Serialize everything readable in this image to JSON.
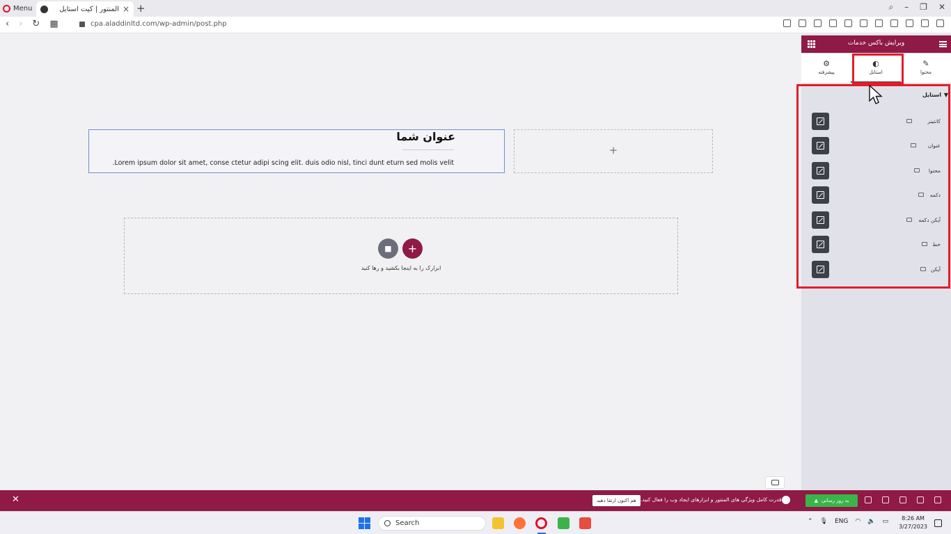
{
  "browser": {
    "menu_label": "Menu",
    "tab_title": "المنتور | کیت استایل",
    "url": "cpa.aladdinltd.com/wp-admin/post.php"
  },
  "canvas": {
    "heading_title": "عنوان شما",
    "heading_text": ".Lorem ipsum dolor sit amet, conse ctetur adipi scing elit. duis odio nisl, tinci dunt eturn sed molis velit",
    "empty_column_plus": "+",
    "add_button": "+",
    "drop_text": "ابزارک را به اینجا بکشید و رها کنید"
  },
  "panel": {
    "title": "ویرایش باکس خدمات",
    "tabs": [
      {
        "label": "محتوا",
        "icon": "pencil-icon"
      },
      {
        "label": "استایل",
        "icon": "contrast-icon"
      },
      {
        "label": "پیشرفته",
        "icon": "gear-icon"
      }
    ],
    "section_title": "استایل",
    "rows": [
      {
        "label": "کانتینر"
      },
      {
        "label": "عنوان"
      },
      {
        "label": "محتوا"
      },
      {
        "label": "دکمه"
      },
      {
        "label": "آیکن دکمه"
      },
      {
        "label": "خط"
      },
      {
        "label": "آیکن"
      }
    ]
  },
  "notice": {
    "text": "قدرت کامل ویژگی های المنتور و ابزارهای ایجاد وب را فعال کنید.",
    "upgrade_label": "هم اکنون ارتقا دهید",
    "update_label": "به روز رسانی"
  },
  "taskbar": {
    "search_label": "Search",
    "language": "ENG",
    "time": "8:26 AM",
    "date": "3/27/2023"
  },
  "colors": {
    "brand": "#8f1a45",
    "highlight": "#e11d2a",
    "update_green": "#39b54a"
  }
}
